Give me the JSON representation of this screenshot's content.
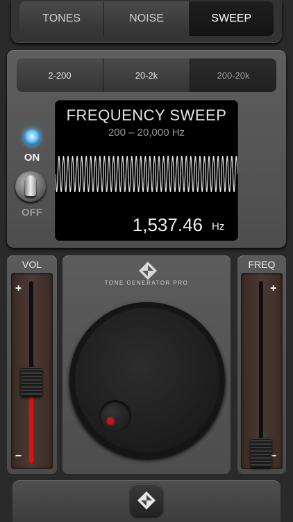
{
  "tabs": [
    {
      "label": "TONES"
    },
    {
      "label": "NOISE"
    },
    {
      "label": "SWEEP",
      "active": true
    }
  ],
  "ranges": [
    {
      "label": "2-200"
    },
    {
      "label": "20-2k"
    },
    {
      "label": "200-20k",
      "active": true
    }
  ],
  "display": {
    "title": "FREQUENCY SWEEP",
    "range": "200 – 20,000 Hz",
    "value": "1,537.46",
    "unit": "Hz"
  },
  "power": {
    "on_label": "ON",
    "off_label": "OFF",
    "state": "on",
    "led_color": "#6fc6ff"
  },
  "volume": {
    "label": "VOL",
    "plus": "+",
    "minus": "–",
    "level": 0.45
  },
  "frequency_slider": {
    "label": "FREQ",
    "plus": "+",
    "minus": "–",
    "level": 0.06
  },
  "brand": {
    "name": "TONE GENERATOR PRO"
  },
  "colors": {
    "accent_red": "#e01010",
    "display_bg": "#000000",
    "led_blue": "#6fc6ff"
  },
  "icons": {
    "brand": "diamond-logo-icon",
    "home": "diamond-logo-icon"
  }
}
